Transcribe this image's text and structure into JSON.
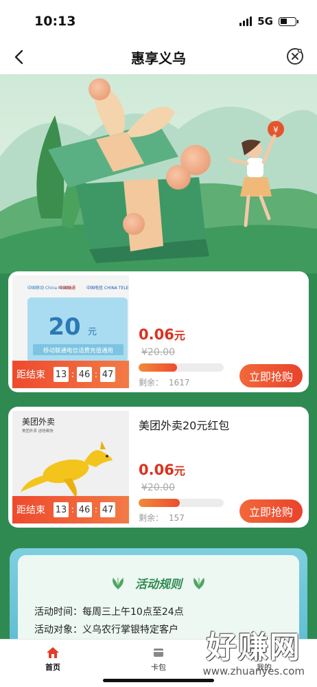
{
  "status_bar": {
    "time": "10:13",
    "network": "5G"
  },
  "nav": {
    "title": "惠享义乌"
  },
  "products": [
    {
      "title": "",
      "price_value": "0.06",
      "price_unit": "元",
      "original_price": "¥20.00",
      "remaining_label": "剩余：",
      "remaining_count": "1617",
      "progress_percent": 45,
      "countdown_label": "距结束",
      "countdown": [
        "13",
        "46",
        "47"
      ],
      "buy_label": "立即抢购",
      "image": {
        "brands": [
          "中国移动 China Mobile",
          "中国联通",
          "中国电信 CHINA TELECOM"
        ],
        "amount": "20",
        "unit": "元",
        "caption": "移动联通电信话费充值通用"
      }
    },
    {
      "title": "美团外卖20元红包",
      "price_value": "0.06",
      "price_unit": "元",
      "original_price": "¥20.00",
      "remaining_label": "剩余：",
      "remaining_count": "157",
      "progress_percent": 48,
      "countdown_label": "距结束",
      "countdown": [
        "13",
        "46",
        "47"
      ],
      "buy_label": "立即抢购",
      "image": {
        "brand": "美团外卖",
        "slogan": "美团外卖 送啥都快"
      }
    }
  ],
  "rules": {
    "title": "活动规则",
    "lines": [
      {
        "label": "活动时间：",
        "value": "每周三上午10点至24点"
      },
      {
        "label": "活动对象：",
        "value": "义乌农行掌银特定客户"
      }
    ]
  },
  "tabs": [
    {
      "label": "首页",
      "icon": "home-icon",
      "active": true
    },
    {
      "label": "卡包",
      "icon": "card-icon",
      "active": false
    },
    {
      "label": "我的",
      "icon": "user-icon",
      "active": false
    }
  ],
  "watermark": {
    "text": "好赚网",
    "url": "www.zhuanyes.com"
  },
  "colors": {
    "primary_green": "#2f8a52",
    "price_red": "#d9331f",
    "button_orange": "#e9432c"
  }
}
